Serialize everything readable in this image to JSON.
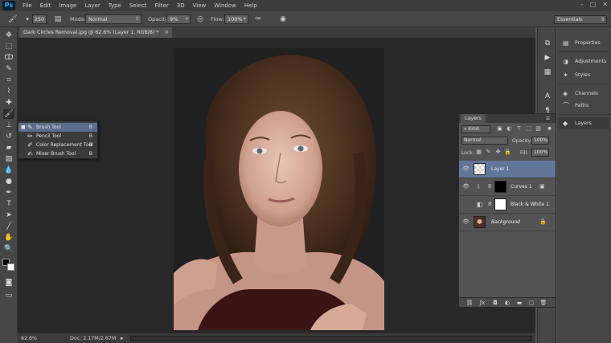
{
  "app": {
    "logo": "Ps",
    "menu": [
      "File",
      "Edit",
      "Image",
      "Layer",
      "Type",
      "Select",
      "Filter",
      "3D",
      "View",
      "Window",
      "Help"
    ]
  },
  "options": {
    "brush_size": "250",
    "mode_label": "Mode:",
    "mode_value": "Normal",
    "opacity_label": "Opacity:",
    "opacity_value": "9%",
    "flow_label": "Flow:",
    "flow_value": "100%",
    "workspace": "Essentials"
  },
  "document": {
    "tab_title": "Dark Circles Removal.jpg @ 62.6% (Layer 1, RGB/8) *",
    "tab_close": "×"
  },
  "flyout": {
    "items": [
      {
        "label": "Brush Tool",
        "key": "B",
        "selected": true
      },
      {
        "label": "Pencil Tool",
        "key": "B",
        "selected": false
      },
      {
        "label": "Color Replacement Tool",
        "key": "B",
        "selected": false
      },
      {
        "label": "Mixer Brush Tool",
        "key": "B",
        "selected": false
      }
    ]
  },
  "status": {
    "zoom": "62.6%",
    "doc": "Doc: 2.17M/2.67M"
  },
  "right_panels": {
    "items": [
      {
        "label": "Properties",
        "icon": "properties-icon"
      },
      {
        "label": "Adjustments",
        "icon": "adjustments-icon"
      },
      {
        "label": "Styles",
        "icon": "styles-icon"
      },
      {
        "label": "Channels",
        "icon": "channels-icon"
      },
      {
        "label": "Paths",
        "icon": "paths-icon"
      },
      {
        "label": "Layers",
        "icon": "layers-icon"
      }
    ]
  },
  "layers_panel": {
    "tab": "Layers",
    "filter_kind": "Kind",
    "blend_mode": "Normal",
    "opacity_label": "Opacity:",
    "opacity_value": "100%",
    "lock_label": "Lock:",
    "fill_label": "Fill:",
    "fill_value": "100%",
    "layers": [
      {
        "name": "Layer 1",
        "selected": true,
        "visible": true
      },
      {
        "name": "Curves 1",
        "selected": false,
        "visible": true
      },
      {
        "name": "Black & White 1",
        "selected": false,
        "visible": false
      },
      {
        "name": "Background",
        "selected": false,
        "visible": true
      }
    ]
  },
  "colors": {
    "selection": "#62769a",
    "flyout_selection": "#5a6d8d",
    "ps_blue": "#31a8ff"
  }
}
